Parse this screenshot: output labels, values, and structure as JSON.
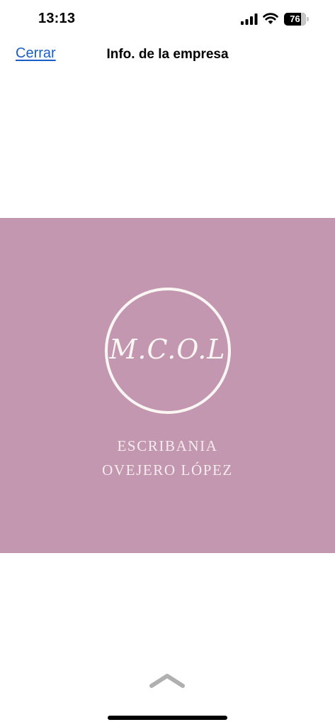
{
  "status_bar": {
    "time": "13:13",
    "battery_level": "76",
    "icons": [
      "signal-icon",
      "wifi-icon",
      "battery-icon"
    ]
  },
  "nav": {
    "close_label": "Cerrar",
    "title": "Info. de la empresa"
  },
  "logo": {
    "background_color": "#c397b0",
    "initials": "M.C.O.L",
    "line1": "ESCRIBANIA",
    "line2": "OVEJERO LÓPEZ"
  },
  "bottom": {
    "icon": "chevron-up-icon"
  },
  "colors": {
    "link": "#1a5fc8",
    "logo_text": "#faf6f3",
    "chevron": "#b0b0b0"
  }
}
